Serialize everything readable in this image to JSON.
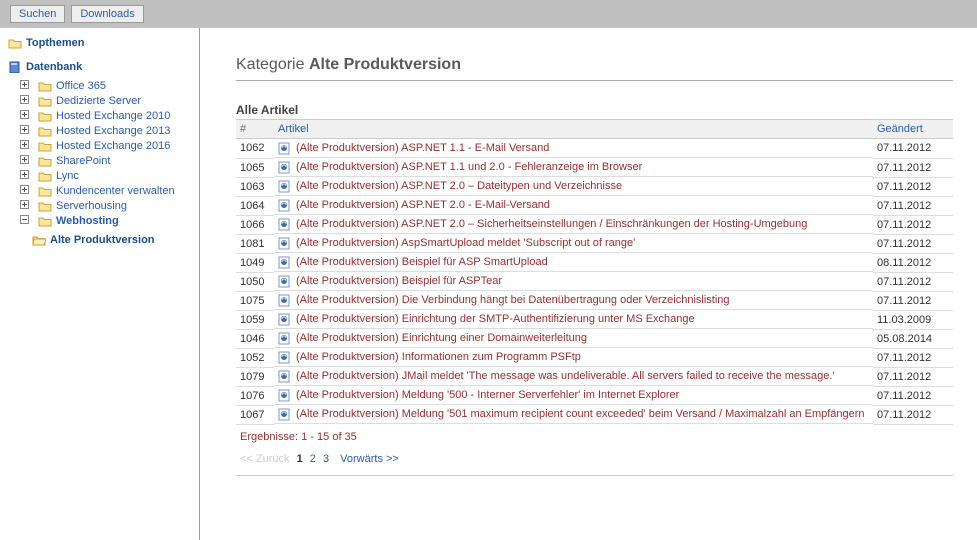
{
  "topbar": {
    "search": "Suchen",
    "downloads": "Downloads"
  },
  "sidebar": {
    "topthemen": "Topthemen",
    "database": "Datenbank",
    "items": [
      {
        "label": "Office 365"
      },
      {
        "label": "Dedizierte Server"
      },
      {
        "label": "Hosted Exchange 2010"
      },
      {
        "label": "Hosted Exchange 2013"
      },
      {
        "label": "Hosted Exchange 2016"
      },
      {
        "label": "SharePoint"
      },
      {
        "label": "Lync"
      },
      {
        "label": "Kundencenter verwalten"
      },
      {
        "label": "Serverhousing"
      },
      {
        "label": "Webhosting",
        "active": true
      }
    ],
    "subitem": {
      "label": "Alte Produktversion"
    }
  },
  "content": {
    "category_prefix": "Kategorie ",
    "category_name": "Alte Produktversion",
    "section": "Alle Artikel",
    "columns": {
      "id": "#",
      "title": "Artikel",
      "changed": "Geändert"
    },
    "rows": [
      {
        "id": "1062",
        "title": "(Alte Produktversion) ASP.NET 1.1 - E-Mail Versand",
        "changed": "07.11.2012"
      },
      {
        "id": "1065",
        "title": "(Alte Produktversion) ASP.NET 1.1 und 2.0 - Fehleranzeige im Browser",
        "changed": "07.11.2012"
      },
      {
        "id": "1063",
        "title": "(Alte Produktversion) ASP.NET 2.0 – Dateitypen und Verzeichnisse",
        "changed": "07.11.2012"
      },
      {
        "id": "1064",
        "title": "(Alte Produktversion) ASP.NET 2.0 - E-Mail-Versand",
        "changed": "07.11.2012"
      },
      {
        "id": "1066",
        "title": "(Alte Produktversion) ASP.NET 2.0 – Sicherheitseinstellungen / Einschränkungen der Hosting-Umgebung",
        "changed": "07.11.2012"
      },
      {
        "id": "1081",
        "title": "(Alte Produktversion) AspSmartUpload meldet 'Subscript out of range'",
        "changed": "07.11.2012"
      },
      {
        "id": "1049",
        "title": "(Alte Produktversion) Beispiel für ASP SmartUpload",
        "changed": "08.11.2012"
      },
      {
        "id": "1050",
        "title": "(Alte Produktversion) Beispiel für ASPTear",
        "changed": "07.11.2012"
      },
      {
        "id": "1075",
        "title": "(Alte Produktversion) Die Verbindung hängt bei Datenübertragung oder Verzeichnislisting",
        "changed": "07.11.2012"
      },
      {
        "id": "1059",
        "title": "(Alte Produktversion) Einrichtung der SMTP-Authentifizierung unter MS Exchange",
        "changed": "11.03.2009"
      },
      {
        "id": "1046",
        "title": "(Alte Produktversion) Einrichtung einer Domainweiterleitung",
        "changed": "05.08.2014"
      },
      {
        "id": "1052",
        "title": "(Alte Produktversion) Informationen zum Programm PSFtp",
        "changed": "07.11.2012"
      },
      {
        "id": "1079",
        "title": "(Alte Produktversion) JMail meldet 'The message was undeliverable. All servers failed to receive the message.'",
        "changed": "07.11.2012"
      },
      {
        "id": "1076",
        "title": "(Alte Produktversion) Meldung '500 - Interner Serverfehler' im Internet Explorer",
        "changed": "07.11.2012"
      },
      {
        "id": "1067",
        "title": "(Alte Produktversion) Meldung '501 maximum recipient count exceeded' beim Versand / Maximalzahl an Empfängern",
        "changed": "07.11.2012"
      }
    ],
    "results": "Ergebnisse: 1 - 15 of 35",
    "pager": {
      "prev": "<< Zurück",
      "pages": [
        "1",
        "2",
        "3"
      ],
      "current": "1",
      "next": "Vorwärts >>"
    }
  }
}
